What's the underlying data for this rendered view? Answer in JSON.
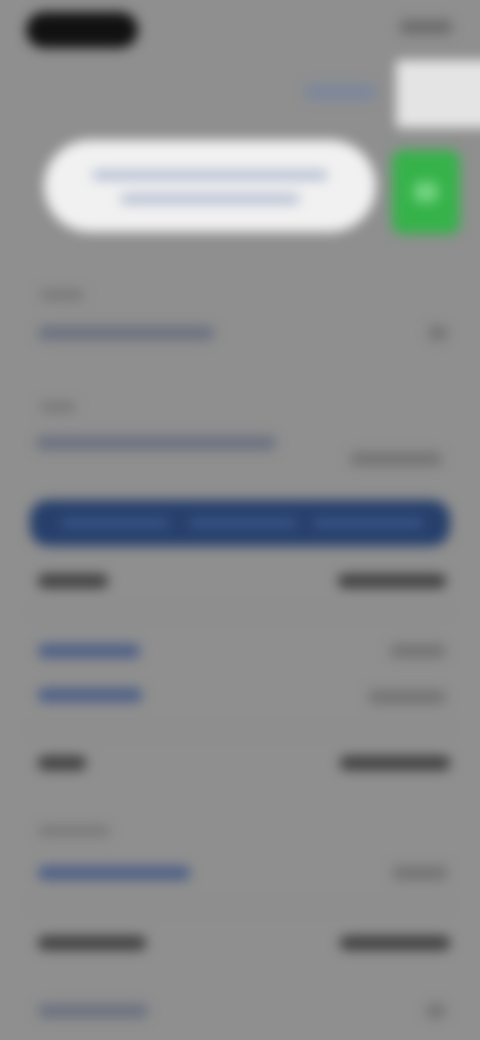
{
  "screen": {
    "background_color": "#8f8f8f",
    "blurred": true
  },
  "colors": {
    "banner": "#f1f1f1",
    "action_green": "#36b24a",
    "primary_bar": "#263f6b"
  }
}
